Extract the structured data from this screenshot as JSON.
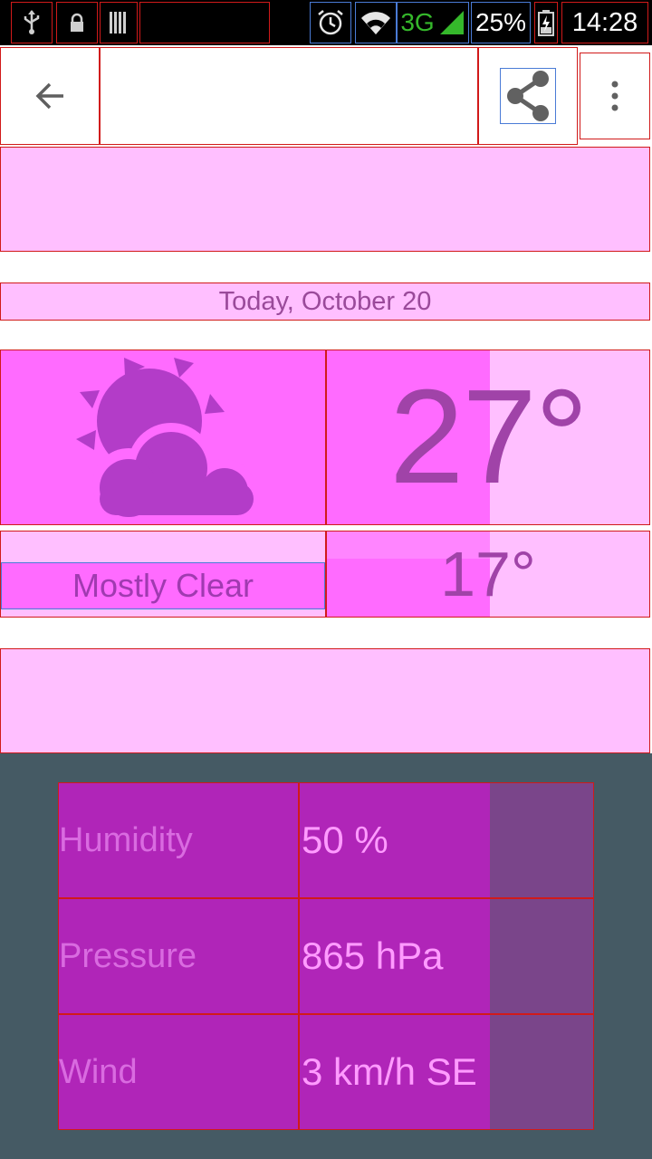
{
  "status_bar": {
    "network_type": "3G",
    "battery_percent": "25%",
    "time": "14:28"
  },
  "action_bar": {
    "icons": [
      "back-arrow-icon",
      "share-icon",
      "overflow-menu-icon"
    ]
  },
  "forecast": {
    "date": "Today, October 20",
    "condition_icon": "partly-cloudy-icon",
    "high": "27°",
    "low": "17°",
    "description": "Mostly Clear"
  },
  "details": [
    {
      "label": "Humidity",
      "value": "50 %"
    },
    {
      "label": "Pressure",
      "value": "865 hPa"
    },
    {
      "label": "Wind",
      "value": "3 km/h SE"
    }
  ],
  "colors": {
    "accent": "#ff6bff",
    "panel": "#455a64",
    "text_accent": "#a043a8"
  }
}
